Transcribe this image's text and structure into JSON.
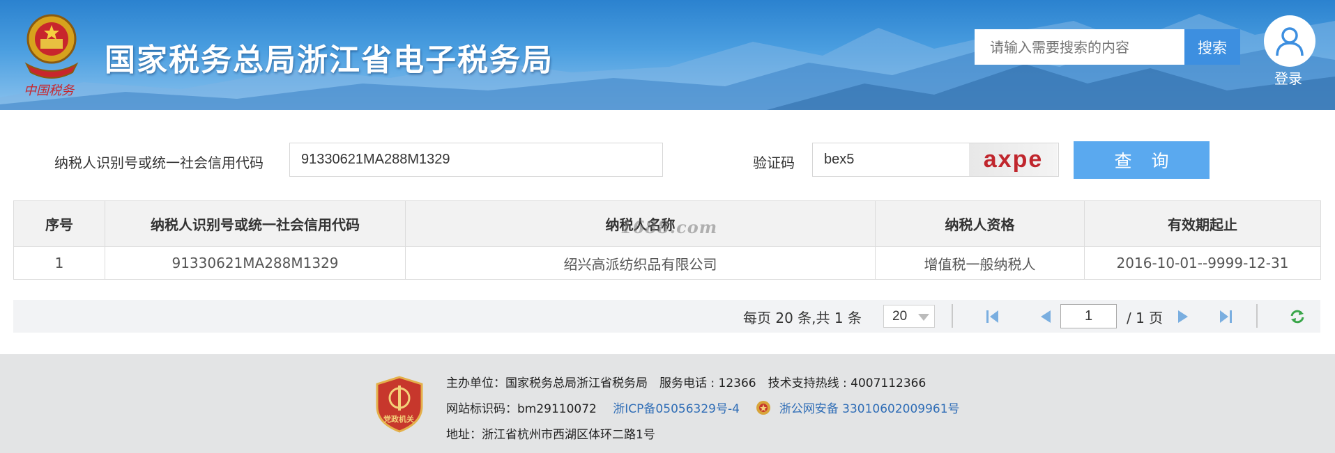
{
  "header": {
    "title": "国家税务总局浙江省电子税务局",
    "search_placeholder": "请输入需要搜索的内容",
    "search_button": "搜索",
    "login_label": "登录",
    "seal_text": "中国税务"
  },
  "query_form": {
    "taxpayer_id_label": "纳税人识别号或统一社会信用代码",
    "taxpayer_id_value": "91330621MA288M1329",
    "captcha_label": "验证码",
    "captcha_input_value": "bex5",
    "captcha_image_text": "axpe",
    "query_button": "查 询"
  },
  "table": {
    "headers": [
      "序号",
      "纳税人识别号或统一社会信用代码",
      "纳税人名称",
      "纳税人资格",
      "有效期起止"
    ],
    "rows": [
      [
        "1",
        "91330621MA288M1329",
        "绍兴高派纺织品有限公司",
        "增值税一般纳税人",
        "2016-10-01--9999-12-31"
      ]
    ]
  },
  "watermark": "1688.com",
  "pagination": {
    "summary": "每页 20 条,共 1 条",
    "page_size": "20",
    "current_page": "1",
    "total_pages": "/ 1 页"
  },
  "footer": {
    "badge_text": "党政机关",
    "line1": "主办单位：国家税务总局浙江省税务局　服务电话 : 12366　技术支持热线 : 4007112366",
    "site_id": "网站标识码：bm29110072",
    "icp": "浙ICP备05056329号-4",
    "police_record": "浙公网安备 33010602009961号",
    "address": "地址：浙江省杭州市西湖区体环二路1号"
  },
  "colors": {
    "header_blue": "#2b82cf",
    "search_button": "#3d8fe0",
    "query_button": "#5aa9ef",
    "link": "#2f6db6",
    "captcha_text": "#c0262d"
  }
}
